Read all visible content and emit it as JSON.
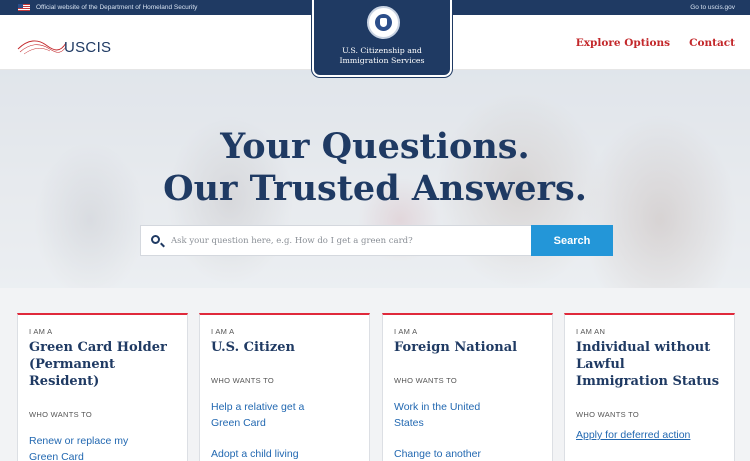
{
  "gov_banner": {
    "official_text": "Official website of the Department of Homeland Security",
    "goto_link": "Go to uscis.gov"
  },
  "header": {
    "logo_text": "USCIS",
    "badge_line1": "U.S. Citizenship and",
    "badge_line2": "Immigration Services",
    "nav": [
      "Explore Options",
      "Contact"
    ]
  },
  "hero": {
    "title_line1": "Your Questions.",
    "title_line2": "Our Trusted Answers.",
    "search_placeholder": "Ask your question here, e.g. How do I get a green card?",
    "search_button": "Search"
  },
  "cards": [
    {
      "iam": "I AM A",
      "title": [
        "Green Card Holder",
        "(Permanent",
        "Resident)"
      ],
      "wants": "WHO WANTS TO",
      "links": [
        "Renew or replace my",
        "Green Card"
      ]
    },
    {
      "iam": "I AM A",
      "title": [
        "U.S. Citizen"
      ],
      "wants": "WHO WANTS TO",
      "links": [
        "Help a relative get a",
        "Green Card",
        "Adopt a child living"
      ]
    },
    {
      "iam": "I AM A",
      "title": [
        "Foreign National"
      ],
      "wants": "WHO WANTS TO",
      "links": [
        "Work in the United",
        "States",
        "Change to another"
      ]
    },
    {
      "iam": "I AM AN",
      "title": [
        "Individual without",
        "Lawful",
        "Immigration Status"
      ],
      "wants": "WHO WANTS TO",
      "links": [
        "Apply for deferred action"
      ]
    }
  ],
  "colors": {
    "navy": "#1f3a63",
    "red_accent": "#c3282b",
    "search_button": "#2396d8",
    "link_blue": "#2268b1"
  },
  "icons": {
    "flag": "us-flag-icon",
    "seal": "dhs-seal-icon",
    "search": "search-icon"
  }
}
